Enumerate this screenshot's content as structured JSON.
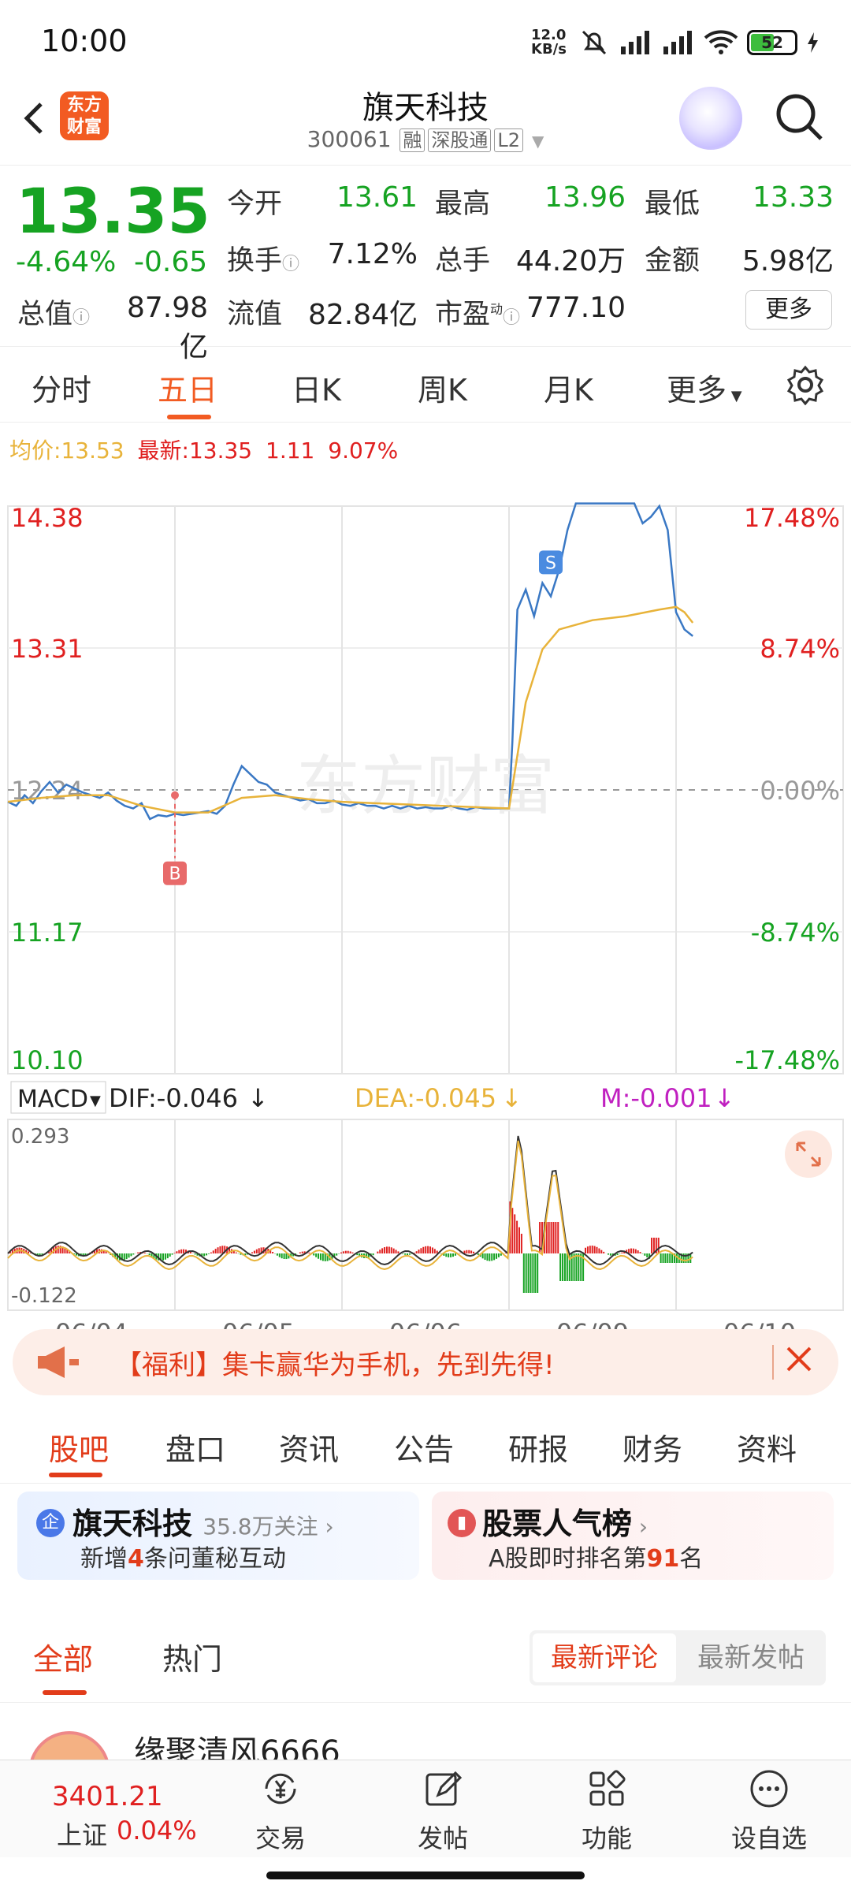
{
  "status": {
    "time": "10:00",
    "net_speed": "12.0 KB/s",
    "battery": "52",
    "battery_level": 0.52
  },
  "header": {
    "title": "旗天科技",
    "code": "300061",
    "tags": [
      "融",
      "深股通",
      "L2"
    ],
    "logo_text": "东方财富"
  },
  "quote": {
    "price": "13.35",
    "change_pct": "-4.64%",
    "change_amt": "-0.65",
    "fields": [
      {
        "label": "今开",
        "value": "13.61",
        "color": "green"
      },
      {
        "label": "最高",
        "value": "13.96",
        "color": "green"
      },
      {
        "label": "最低",
        "value": "13.33",
        "color": "green"
      },
      {
        "label": "换手",
        "value": "7.12%",
        "color": "dark"
      },
      {
        "label": "总手",
        "value": "44.20万",
        "color": "dark"
      },
      {
        "label": "金额",
        "value": "5.98亿",
        "color": "dark"
      },
      {
        "label": "总值",
        "value": "87.98亿",
        "color": "dark"
      },
      {
        "label": "流值",
        "value": "82.84亿",
        "color": "dark"
      },
      {
        "label": "市盈",
        "value": "777.10",
        "color": "dark"
      }
    ],
    "pe_sup": "动",
    "more": "更多"
  },
  "period_tabs": [
    "分时",
    "五日",
    "日K",
    "周K",
    "月K",
    "更多"
  ],
  "active_period": "五日",
  "legend": {
    "avg_label": "均价:",
    "avg_value": "13.53",
    "latest_label": "最新:",
    "latest_value": "13.35",
    "diff": "1.11",
    "pct": "9.07%"
  },
  "chart_data": {
    "type": "line",
    "title": "",
    "x_dates": [
      "06/04",
      "06/05",
      "06/06",
      "06/09",
      "06/10"
    ],
    "y_left_ticks": [
      "14.38",
      "13.31",
      "12.24",
      "11.17",
      "10.10"
    ],
    "y_right_ticks": [
      "17.48%",
      "8.74%",
      "0.00%",
      "-8.74%",
      "-17.48%"
    ],
    "ylim": [
      10.1,
      14.38
    ],
    "prev_close": 12.24,
    "series": [
      {
        "name": "price",
        "color": "#3a78c4",
        "x": [
          0,
          0.05,
          0.1,
          0.15,
          0.2,
          0.25,
          0.3,
          0.35,
          0.4,
          0.45,
          0.5,
          0.55,
          0.6,
          0.65,
          0.7,
          0.75,
          0.8,
          0.85,
          0.9,
          0.95,
          1.0,
          1.05,
          1.1,
          1.15,
          1.2,
          1.25,
          1.3,
          1.35,
          1.4,
          1.45,
          1.5,
          1.55,
          1.6,
          1.65,
          1.7,
          1.75,
          1.8,
          1.85,
          1.9,
          1.95,
          2.0,
          2.05,
          2.1,
          2.15,
          2.2,
          2.25,
          2.3,
          2.35,
          2.4,
          2.45,
          2.5,
          2.55,
          2.6,
          2.65,
          2.7,
          2.75,
          2.8,
          2.85,
          2.9,
          2.95,
          3.0,
          3.02,
          3.05,
          3.1,
          3.15,
          3.2,
          3.25,
          3.3,
          3.35,
          3.4,
          3.45,
          3.5,
          3.55,
          3.6,
          3.65,
          3.7,
          3.75,
          3.8,
          3.85,
          3.9,
          3.95,
          4.0,
          4.05,
          4.1
        ],
        "values": [
          12.15,
          12.12,
          12.2,
          12.14,
          12.23,
          12.3,
          12.22,
          12.28,
          12.25,
          12.22,
          12.2,
          12.18,
          12.22,
          12.16,
          12.12,
          12.1,
          12.14,
          12.02,
          12.05,
          12.04,
          12.06,
          12.05,
          12.06,
          12.07,
          12.08,
          12.06,
          12.12,
          12.28,
          12.42,
          12.36,
          12.3,
          12.28,
          12.22,
          12.2,
          12.18,
          12.16,
          12.17,
          12.14,
          12.14,
          12.16,
          12.13,
          12.12,
          12.14,
          12.12,
          12.12,
          12.1,
          12.12,
          12.1,
          12.12,
          12.1,
          12.11,
          12.1,
          12.1,
          12.12,
          12.1,
          12.09,
          12.11,
          12.1,
          12.1,
          12.1,
          12.1,
          12.6,
          13.6,
          13.75,
          13.55,
          13.8,
          13.7,
          13.9,
          14.2,
          14.4,
          14.4,
          14.4,
          14.4,
          14.4,
          14.4,
          14.4,
          14.4,
          14.25,
          14.3,
          14.38,
          14.2,
          13.58,
          13.45,
          13.4
        ]
      },
      {
        "name": "avg",
        "color": "#e8b33a",
        "x": [
          0,
          0.2,
          0.4,
          0.6,
          0.8,
          1.0,
          1.2,
          1.4,
          1.6,
          1.8,
          2.0,
          2.2,
          2.4,
          2.6,
          2.8,
          3.0,
          3.05,
          3.1,
          3.2,
          3.3,
          3.5,
          3.7,
          3.9,
          4.0,
          4.05,
          4.1
        ],
        "values": [
          12.15,
          12.18,
          12.2,
          12.2,
          12.12,
          12.07,
          12.07,
          12.18,
          12.2,
          12.17,
          12.15,
          12.14,
          12.13,
          12.12,
          12.11,
          12.1,
          12.5,
          12.9,
          13.3,
          13.45,
          13.52,
          13.55,
          13.6,
          13.62,
          13.58,
          13.5
        ]
      }
    ],
    "markers": [
      {
        "label": "B",
        "date_index": 1.0,
        "price": 12.2
      },
      {
        "label": "S",
        "date_index": 3.25,
        "price": 13.95
      }
    ],
    "macd": {
      "label": "MACD",
      "dif": "DIF:-0.046",
      "dea": "DEA:-0.045",
      "m": "M:-0.001",
      "ymax": "0.293",
      "ymin": "-0.122"
    }
  },
  "watermark": "东方财富",
  "marquee": {
    "text": "【福利】集卡赢华为手机，先到先得!"
  },
  "bottom_tabs": [
    "股吧",
    "盘口",
    "资讯",
    "公告",
    "研报",
    "财务",
    "资料"
  ],
  "cards": [
    {
      "name": "旗天科技",
      "follow": "35.8万关注",
      "line_pre": "新增",
      "line_num": "4",
      "line_post": "条问董秘互动",
      "icon": "企"
    },
    {
      "name": "股票人气榜",
      "line_pre": "A股即时排名第",
      "line_num": "91",
      "line_post": "名"
    }
  ],
  "feed_tabs": [
    "全部",
    "热门"
  ],
  "feed_seg": [
    "最新评论",
    "最新发帖"
  ],
  "post": {
    "user": "缘聚清风6666"
  },
  "nav": {
    "index_value": "3401.21",
    "index_name": "上证",
    "index_pct": "0.04%",
    "items": [
      "交易",
      "发帖",
      "功能",
      "设自选"
    ]
  }
}
